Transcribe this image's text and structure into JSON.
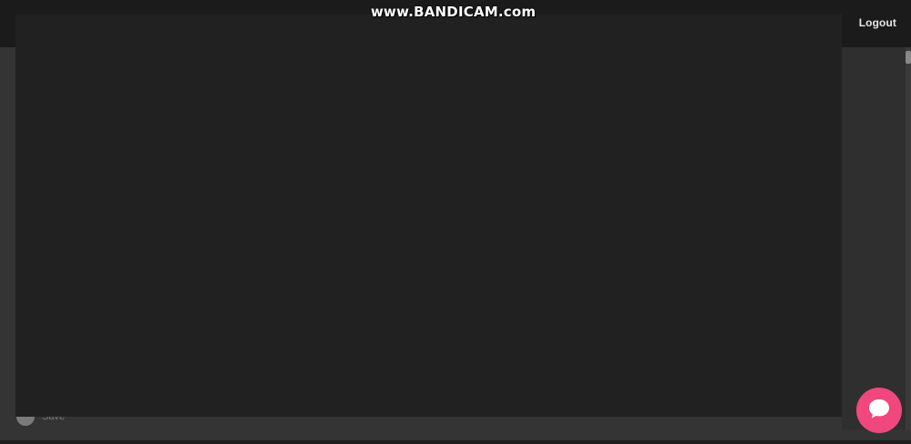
{
  "header": {
    "brand_text": "",
    "logout_label": "Logout"
  },
  "watermark": {
    "text": "www.BANDICAM.com"
  },
  "footer": {
    "user_name": "Save"
  },
  "colors": {
    "header_bg": "#1b1b1b",
    "page_bg": "#353535",
    "modal_bg": "#212121",
    "chat_button": "#f0487e"
  },
  "icons": {
    "chat": "chat-bubble-icon"
  }
}
